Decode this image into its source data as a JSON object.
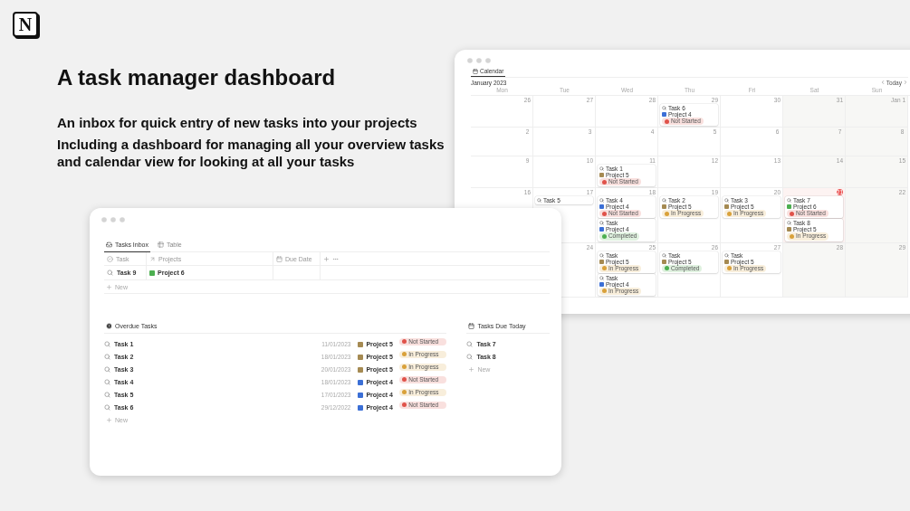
{
  "logo": {
    "text": "N"
  },
  "headline": "A task manager dashboard",
  "taglines": [
    "An inbox for quick entry of new tasks into your projects",
    "Including a dashboard for managing all your overview tasks and calendar view for looking at all your tasks"
  ],
  "calendar_window": {
    "tab": "Calendar",
    "month": "January 2023",
    "today_button": "Today",
    "weekdays": [
      "Mon",
      "Tue",
      "Wed",
      "Thu",
      "Fri",
      "Sat",
      "Sun"
    ],
    "weeks": [
      {
        "days": [
          {
            "day": "26",
            "today": false
          },
          {
            "day": "27",
            "today": false
          },
          {
            "day": "28",
            "today": false
          },
          {
            "day": "29",
            "today": false,
            "events": [
              {
                "task": "Task 6",
                "project": {
                  "name": "Project 4",
                  "color": "#3b6fd6"
                },
                "status": {
                  "label": "Not Started",
                  "color": "#e0524a"
                }
              }
            ]
          },
          {
            "day": "30",
            "today": false
          },
          {
            "day": "31",
            "today": false
          },
          {
            "day": "Jan 1",
            "today": false
          }
        ]
      },
      {
        "days": [
          {
            "day": "2",
            "today": false
          },
          {
            "day": "3",
            "today": false
          },
          {
            "day": "4",
            "today": false
          },
          {
            "day": "5",
            "today": false
          },
          {
            "day": "6",
            "today": false
          },
          {
            "day": "7",
            "today": false
          },
          {
            "day": "8",
            "today": false
          }
        ]
      },
      {
        "days": [
          {
            "day": "9",
            "today": false
          },
          {
            "day": "10",
            "today": false
          },
          {
            "day": "11",
            "today": false,
            "events": [
              {
                "task": "Task 1",
                "project": {
                  "name": "Project 5",
                  "color": "#a58a52"
                },
                "status": {
                  "label": "Not Started",
                  "color": "#e0524a"
                }
              }
            ]
          },
          {
            "day": "12",
            "today": false
          },
          {
            "day": "13",
            "today": false
          },
          {
            "day": "14",
            "today": false
          },
          {
            "day": "15",
            "today": false
          }
        ]
      },
      {
        "days": [
          {
            "day": "16",
            "today": false
          },
          {
            "day": "17",
            "today": false,
            "events": [
              {
                "task": "Task 5"
              }
            ]
          },
          {
            "day": "18",
            "today": false,
            "events": [
              {
                "task": "Task 4",
                "project": {
                  "name": "Project 4",
                  "color": "#3b6fd6"
                },
                "status": {
                  "label": "Not Started",
                  "color": "#e0524a"
                }
              },
              {
                "task": "Task",
                "project": {
                  "name": "Project 4",
                  "color": "#3b6fd6"
                },
                "status": {
                  "label": "Completed",
                  "color": "#4caf50"
                }
              }
            ]
          },
          {
            "day": "19",
            "today": false,
            "events": [
              {
                "task": "Task 2",
                "project": {
                  "name": "Project 5",
                  "color": "#a58a52"
                },
                "status": {
                  "label": "In Progress",
                  "color": "#d9a13a"
                }
              }
            ]
          },
          {
            "day": "20",
            "today": false,
            "events": [
              {
                "task": "Task 3",
                "project": {
                  "name": "Project 5",
                  "color": "#a58a52"
                },
                "status": {
                  "label": "In Progress",
                  "color": "#d9a13a"
                }
              }
            ]
          },
          {
            "day": "21",
            "today": true,
            "events": [
              {
                "task": "Task 7",
                "project": {
                  "name": "Project 6",
                  "color": "#4caf50"
                },
                "status": {
                  "label": "Not Started",
                  "color": "#e0524a"
                }
              },
              {
                "task": "Task 8",
                "project": {
                  "name": "Project 5",
                  "color": "#a58a52"
                },
                "status": {
                  "label": "In Progress",
                  "color": "#d9a13a"
                }
              }
            ]
          },
          {
            "day": "22",
            "today": false
          }
        ]
      },
      {
        "leading_blank": true,
        "days": [
          {
            "day": "24",
            "today": false
          },
          {
            "day": "25",
            "today": false,
            "events": [
              {
                "task": "Task",
                "project": {
                  "name": "Project 5",
                  "color": "#a58a52"
                },
                "status": {
                  "label": "In Progress",
                  "color": "#d9a13a"
                }
              },
              {
                "task": "Task",
                "project": {
                  "name": "Project 4",
                  "color": "#3b6fd6"
                },
                "status": {
                  "label": "In Progress",
                  "color": "#d9a13a"
                }
              }
            ]
          },
          {
            "day": "26",
            "today": false,
            "events": [
              {
                "task": "Task",
                "project": {
                  "name": "Project 5",
                  "color": "#a58a52"
                },
                "status": {
                  "label": "Completed",
                  "color": "#4caf50"
                }
              }
            ]
          },
          {
            "day": "27",
            "today": false,
            "events": [
              {
                "task": "Task",
                "project": {
                  "name": "Project 5",
                  "color": "#a58a52"
                },
                "status": {
                  "label": "In Progress",
                  "color": "#d9a13a"
                }
              }
            ]
          },
          {
            "day": "28",
            "today": false
          },
          {
            "day": "29",
            "today": false
          }
        ]
      }
    ]
  },
  "inbox_window": {
    "tabs": [
      {
        "label": "Tasks Inbox",
        "selected": true
      },
      {
        "label": "Table",
        "selected": false
      }
    ],
    "columns": [
      "Task",
      "Projects",
      "Due Date"
    ],
    "rows": [
      {
        "task": "Task 9",
        "project": {
          "name": "Project 6",
          "color": "#4caf50"
        }
      }
    ],
    "new_label": "New",
    "overdue": {
      "title": "Overdue Tasks",
      "new_label": "New",
      "rows": [
        {
          "task": "Task 1",
          "date": "11/01/2023",
          "project": {
            "name": "Project 5",
            "color": "#a58a52"
          },
          "status": {
            "label": "Not Started",
            "color": "#e0524a"
          }
        },
        {
          "task": "Task 2",
          "date": "18/01/2023",
          "project": {
            "name": "Project 5",
            "color": "#a58a52"
          },
          "status": {
            "label": "In Progress",
            "color": "#d9a13a"
          }
        },
        {
          "task": "Task 3",
          "date": "20/01/2023",
          "project": {
            "name": "Project 5",
            "color": "#a58a52"
          },
          "status": {
            "label": "In Progress",
            "color": "#d9a13a"
          }
        },
        {
          "task": "Task 4",
          "date": "18/01/2023",
          "project": {
            "name": "Project 4",
            "color": "#3b6fd6"
          },
          "status": {
            "label": "Not Started",
            "color": "#e0524a"
          }
        },
        {
          "task": "Task 5",
          "date": "17/01/2023",
          "project": {
            "name": "Project 4",
            "color": "#3b6fd6"
          },
          "status": {
            "label": "In Progress",
            "color": "#d9a13a"
          }
        },
        {
          "task": "Task 6",
          "date": "29/12/2022",
          "project": {
            "name": "Project 4",
            "color": "#3b6fd6"
          },
          "status": {
            "label": "Not Started",
            "color": "#e0524a"
          }
        }
      ]
    },
    "due_today": {
      "title": "Tasks Due Today",
      "new_label": "New",
      "rows": [
        {
          "task": "Task 7"
        },
        {
          "task": "Task 8"
        }
      ]
    }
  }
}
